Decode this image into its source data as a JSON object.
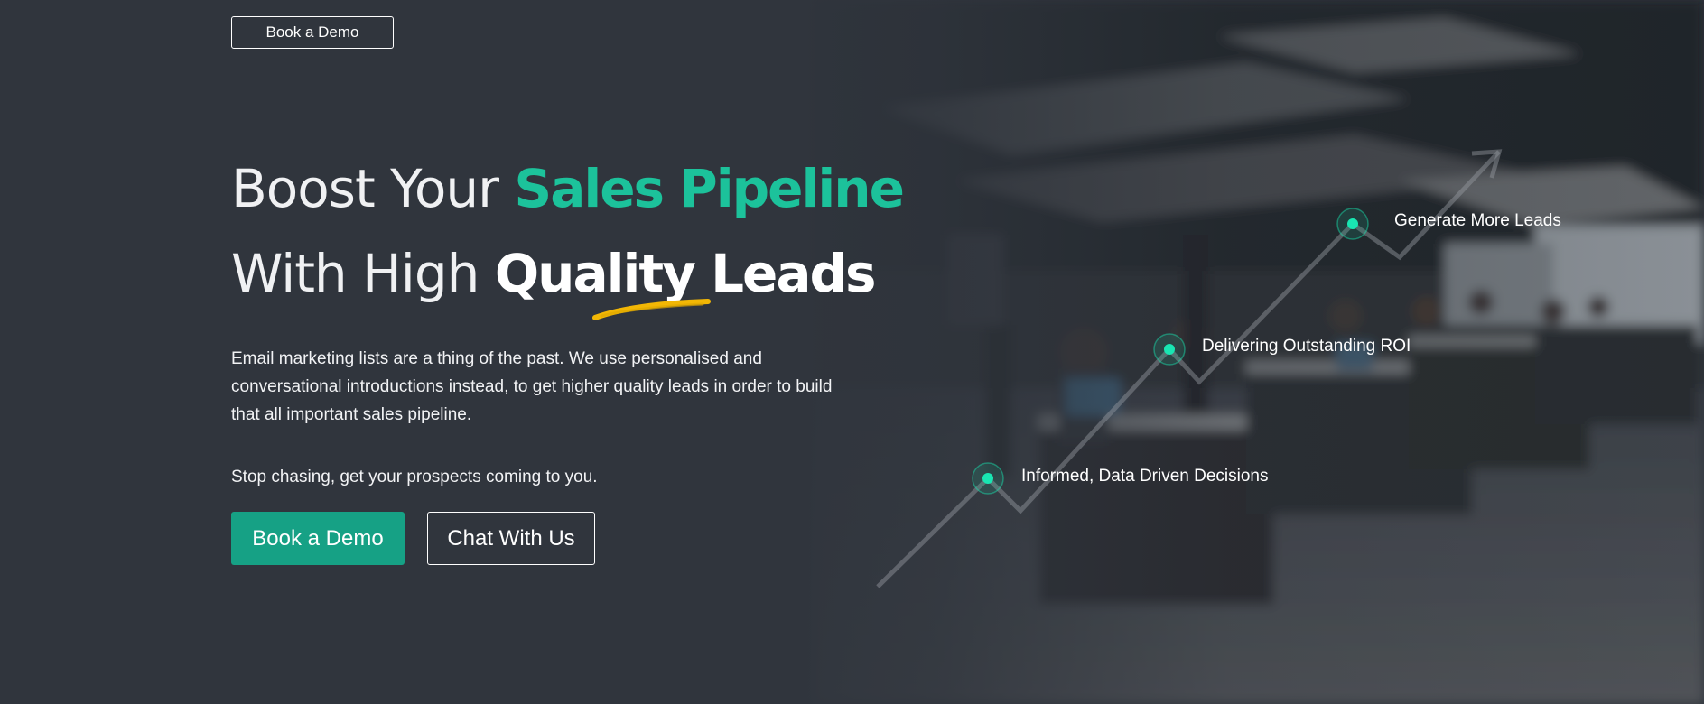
{
  "header": {
    "demo_button": "Book a Demo"
  },
  "hero": {
    "headline_line1_plain": "Boost Your ",
    "headline_line1_accent": "Sales Pipeline",
    "headline_line2_plain": "With High ",
    "headline_line2_strong": "Quality Leads",
    "description": "Email marketing lists are a thing of the past. We use personalised and conversational introductions instead, to get higher quality leads in order to build that all important sales pipeline.",
    "tagline": "Stop chasing, get your prospects coming to you.",
    "primary_button": "Book a Demo",
    "secondary_button": "Chat With Us"
  },
  "graph": {
    "points": [
      {
        "label": "Informed, Data Driven Decisions"
      },
      {
        "label": "Delivering Outstanding ROI"
      },
      {
        "label": "Generate More Leads"
      }
    ]
  },
  "colors": {
    "accent": "#1cc29b",
    "primary_button": "#16a185",
    "underline": "#f2b705",
    "background": "#30353d",
    "dot": "#19e6b2"
  }
}
